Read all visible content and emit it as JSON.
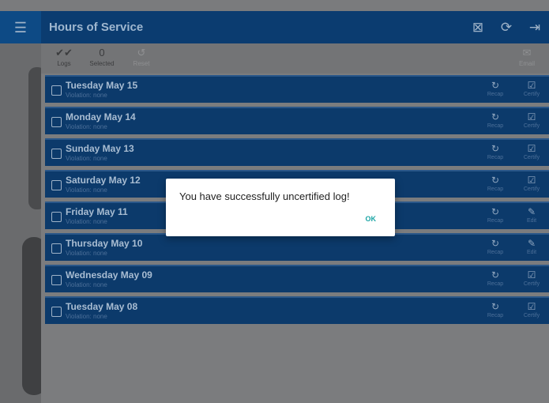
{
  "header": {
    "title": "Hours of Service",
    "menu_icon": "menu-icon",
    "actions": [
      {
        "name": "upload-icon",
        "glyph": "⊠"
      },
      {
        "name": "refresh-icon",
        "glyph": "⟳"
      },
      {
        "name": "logout-icon",
        "glyph": "⇥"
      }
    ]
  },
  "toolbar": {
    "logs_label": "Logs",
    "selected_count": "0",
    "selected_label": "Selected",
    "reset_label": "Reset",
    "email_label": "Email"
  },
  "logs": [
    {
      "day": "Tuesday May 15",
      "violation": "Violation: none",
      "recap": "Recap",
      "action": "Certify"
    },
    {
      "day": "Monday May 14",
      "violation": "Violation: none",
      "recap": "Recap",
      "action": "Certify"
    },
    {
      "day": "Sunday May 13",
      "violation": "Violation: none",
      "recap": "Recap",
      "action": "Certify"
    },
    {
      "day": "Saturday May 12",
      "violation": "Violation: none",
      "recap": "Recap",
      "action": "Certify"
    },
    {
      "day": "Friday May 11",
      "violation": "Violation: none",
      "recap": "Recap",
      "action": "Edit"
    },
    {
      "day": "Thursday May 10",
      "violation": "Violation: none",
      "recap": "Recap",
      "action": "Edit"
    },
    {
      "day": "Wednesday May 09",
      "violation": "Violation: none",
      "recap": "Recap",
      "action": "Certify"
    },
    {
      "day": "Tuesday May 08",
      "violation": "Violation: none",
      "recap": "Recap",
      "action": "Certify"
    }
  ],
  "dialog": {
    "message": "You have successfully uncertified log!",
    "ok_label": "OK"
  },
  "colors": {
    "header_bg": "#0b3c70",
    "row_bg": "#0c3a6b",
    "dialog_button": "#1aa5a5"
  }
}
